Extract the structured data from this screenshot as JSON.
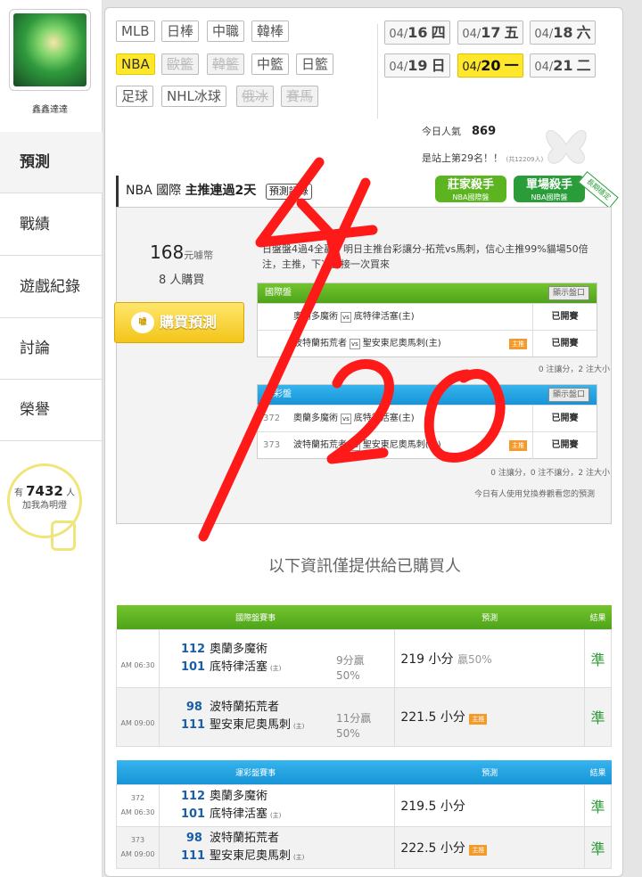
{
  "user": {
    "name": "鑫鑫達達"
  },
  "sidebar": {
    "items": [
      {
        "label": "預測"
      },
      {
        "label": "戰績"
      },
      {
        "label": "遊戲紀錄"
      },
      {
        "label": "討論"
      },
      {
        "label": "榮譽"
      }
    ]
  },
  "fans": {
    "prefix": "有",
    "count": "7432",
    "suffix": "人",
    "sub": "加我為明燈"
  },
  "leagues": [
    "MLB",
    "日棒",
    "中職",
    "韓棒",
    "NBA",
    "歐籃",
    "韓籃",
    "中籃",
    "日籃",
    "足球",
    "NHL冰球",
    "俄冰",
    "賽馬"
  ],
  "dates": [
    {
      "md": "04/",
      "d": "16",
      "w": "四"
    },
    {
      "md": "04/",
      "d": "17",
      "w": "五"
    },
    {
      "md": "04/",
      "d": "18",
      "w": "六"
    },
    {
      "md": "04/",
      "d": "19",
      "w": "日"
    },
    {
      "md": "04/",
      "d": "20",
      "w": "一"
    },
    {
      "md": "04/",
      "d": "21",
      "w": "二"
    }
  ],
  "popularity": {
    "label": "今日人氣",
    "value": "869",
    "rank": "是站上第29名！！",
    "total": "(共12209人)"
  },
  "pick": {
    "title": "NBA 國際",
    "streak": "主推連過2天",
    "record_btn": "預測記錄",
    "badge1": "莊家殺手",
    "badge1_sub": "NBA國際盤",
    "badge2": "單場殺手",
    "badge2_sub": "NBA國際盤",
    "ribbon": "長期穩定"
  },
  "purchase": {
    "price": "168",
    "unit": "元噱幣",
    "buyers_count": "8",
    "buyers_label": "人購買",
    "button": "購買預測",
    "button_icon": "噱"
  },
  "summary": "日盤盤4過4全贏，明日主推台彩讓分-拓荒vs馬刺，信心主推99%貓場50倍注，主推，下次直接一次買來",
  "intl": {
    "title": "國際盤",
    "spread_btn": "顯示盤口",
    "games": [
      {
        "no": "",
        "home": "奧蘭多魔術",
        "away": "底特律活塞(主)",
        "hot": "",
        "status": "已開賽"
      },
      {
        "no": "",
        "home": "波特蘭拓荒者",
        "away": "聖安東尼奧馬刺(主)",
        "hot": "主推",
        "status": "已開賽"
      }
    ],
    "stats": "0 注讓分，2 注大小"
  },
  "lottery": {
    "title": "運彩盤",
    "spread_btn": "顯示盤口",
    "games": [
      {
        "no": "372",
        "home": "奧蘭多魔術",
        "away": "底特律活塞(主)",
        "hot": "",
        "status": "已開賽"
      },
      {
        "no": "373",
        "home": "波特蘭拓荒者",
        "away": "聖安東尼奧馬刺(主)",
        "hot": "主推",
        "status": "已開賽"
      }
    ],
    "stats": "0 注讓分，0 注不讓分，2 注大小"
  },
  "voucher_note": "今日有人使用兌換券觀看您的預測",
  "notice": "以下資訊僅提供給已購買人",
  "intl_table": {
    "headers": [
      "國際盤賽事",
      "預測",
      "結果"
    ],
    "rows": [
      {
        "no": "",
        "time": "AM 06:30",
        "s1": "112",
        "t1": "奧蘭多魔術",
        "s2": "101",
        "t2": "底特律活塞",
        "margin": "9分贏",
        "pct": "50%",
        "pick": "219 小分",
        "pick_extra": "贏50%",
        "result": "準"
      },
      {
        "no": "",
        "time": "AM 09:00",
        "s1": "98",
        "t1": "波特蘭拓荒者",
        "s2": "111",
        "t2": "聖安東尼奧馬刺",
        "margin": "11分贏",
        "pct": "50%",
        "pick": "221.5 小分",
        "pick_extra": "主推",
        "result": "準"
      }
    ]
  },
  "lottery_table": {
    "headers": [
      "運彩盤賽事",
      "預測",
      "結果"
    ],
    "rows": [
      {
        "no": "372",
        "time": "AM 06:30",
        "s1": "112",
        "t1": "奧蘭多魔術",
        "s2": "101",
        "t2": "底特律活塞",
        "pick": "219.5 小分",
        "pick_extra": "",
        "result": "準"
      },
      {
        "no": "373",
        "time": "AM 09:00",
        "s1": "98",
        "t1": "波特蘭拓荒者",
        "s2": "111",
        "t2": "聖安東尼奧馬刺",
        "pick": "222.5 小分",
        "pick_extra": "主推",
        "result": "準"
      }
    ]
  },
  "home_mark": "(主)",
  "overlay": {
    "text": "4/20",
    "color": "#ff1a1a"
  }
}
